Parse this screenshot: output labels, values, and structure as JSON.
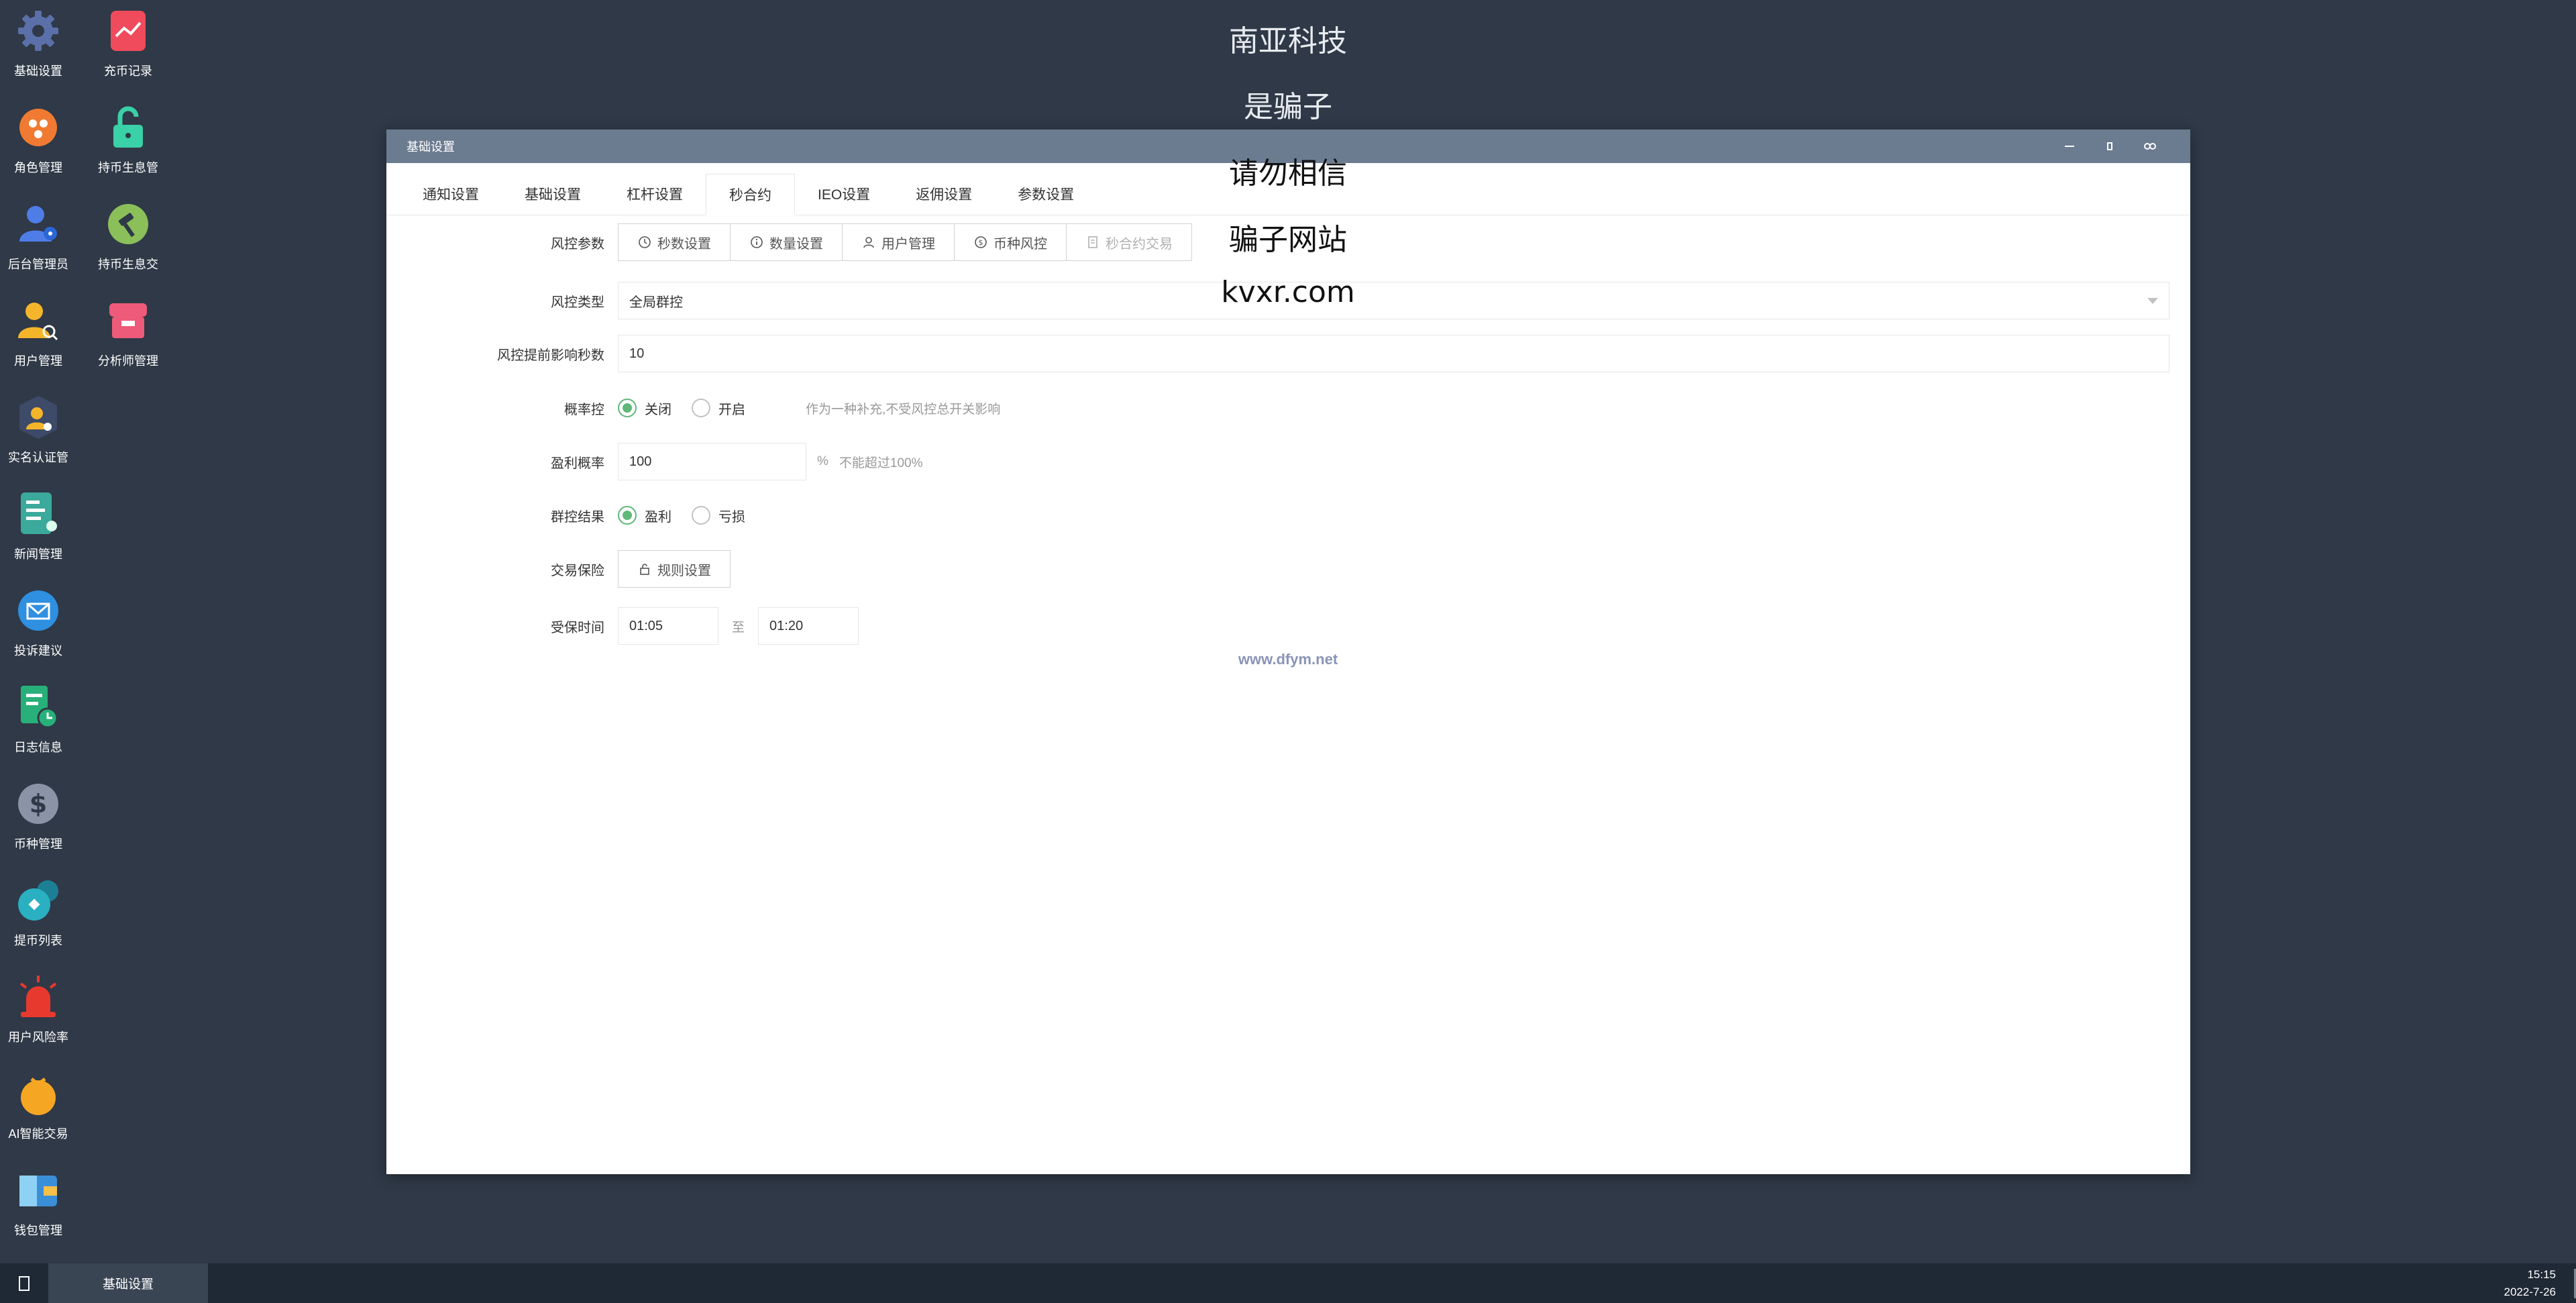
{
  "desktop": {
    "icons": [
      {
        "label": "基础设置",
        "icon": "gear-icon",
        "color": "#5b6fa8"
      },
      {
        "label": "充币记录",
        "icon": "chart-card-icon",
        "color": "#ef4b5c"
      },
      {
        "label": "角色管理",
        "icon": "roles-icon",
        "color": "#f07a32"
      },
      {
        "label": "持币生息管",
        "icon": "unlock-icon",
        "color": "#3ad0a8"
      },
      {
        "label": "后台管理员",
        "icon": "admin-user-icon",
        "color": "#4f7de8"
      },
      {
        "label": "持币生息交",
        "icon": "hammer-icon",
        "color": "#8bbf5a"
      },
      {
        "label": "用户管理",
        "icon": "user-search-icon",
        "color": "#f5b52a"
      },
      {
        "label": "分析师管理",
        "icon": "shop-icon",
        "color": "#ee5a7a"
      },
      {
        "label": "实名认证管",
        "icon": "verified-user-icon",
        "color": "#3d4a68"
      },
      {
        "label": "新闻管理",
        "icon": "news-icon",
        "color": "#3ba99c"
      },
      {
        "label": "投诉建议",
        "icon": "mail-icon",
        "color": "#2f8fe0"
      },
      {
        "label": "日志信息",
        "icon": "log-icon",
        "color": "#28b07a"
      },
      {
        "label": "币种管理",
        "icon": "dollar-icon",
        "color": "#8a94a6"
      },
      {
        "label": "提币列表",
        "icon": "withdraw-icon",
        "color": "#2ab0c0"
      },
      {
        "label": "用户风险率",
        "icon": "alarm-icon",
        "color": "#e8392f"
      },
      {
        "label": "AI智能交易",
        "icon": "ai-bag-icon",
        "color": "#f5a623"
      },
      {
        "label": "钱包管理",
        "icon": "wallet-icon",
        "color": "#3b8fd8"
      }
    ]
  },
  "watermark": {
    "lines": [
      "南亚科技",
      "是骗子",
      "请勿相信",
      "骗子网站",
      "kvxr.com"
    ],
    "site": "www.dfym.net"
  },
  "window": {
    "title": "基础设置",
    "controls": {
      "minimize": "minimize-icon",
      "maximize": "maximize-icon",
      "close": "close-icon"
    }
  },
  "tabs": [
    "通知设置",
    "基础设置",
    "杠杆设置",
    "秒合约",
    "IEO设置",
    "返佣设置",
    "参数设置"
  ],
  "active_tab": "秒合约",
  "form": {
    "risk_params": {
      "label": "风控参数",
      "buttons": [
        {
          "label": "秒数设置",
          "icon": "clock-icon"
        },
        {
          "label": "数量设置",
          "icon": "info-icon"
        },
        {
          "label": "用户管理",
          "icon": "user-icon"
        },
        {
          "label": "币种风控",
          "icon": "coin-icon"
        },
        {
          "label": "秒合约交易",
          "icon": "doc-icon"
        }
      ]
    },
    "risk_type": {
      "label": "风控类型",
      "value": "全局群控"
    },
    "advance_seconds": {
      "label": "风控提前影响秒数",
      "value": "10"
    },
    "probability_control": {
      "label": "概率控",
      "options": [
        "关闭",
        "开启"
      ],
      "selected": "关闭",
      "hint": "作为一种补充,不受风控总开关影响"
    },
    "profit_probability": {
      "label": "盈利概率",
      "value": "100",
      "unit": "%",
      "hint": "不能超过100%"
    },
    "group_result": {
      "label": "群控结果",
      "options": [
        "盈利",
        "亏损"
      ],
      "selected": "盈利"
    },
    "insurance": {
      "label": "交易保险",
      "button": "规则设置"
    },
    "insured_time": {
      "label": "受保时间",
      "from": "01:05",
      "sep": "至",
      "to": "01:20"
    }
  },
  "taskbar": {
    "active_task": "基础设置",
    "time": "15:15",
    "date": "2022-7-26"
  },
  "colors": {
    "desktop_bg": "#2f3947",
    "titlebar": "#6b7b90",
    "radio_checked": "#5fb878",
    "taskbar": "#1f2835"
  }
}
